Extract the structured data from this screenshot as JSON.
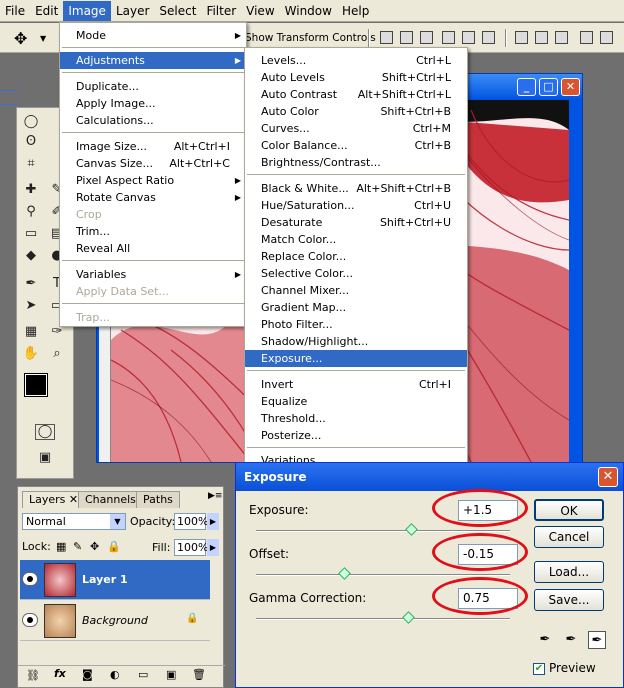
{
  "menubar": {
    "items": [
      "File",
      "Edit",
      "Image",
      "Layer",
      "Select",
      "Filter",
      "View",
      "Window",
      "Help"
    ],
    "active": "Image"
  },
  "optionsbar": {
    "show_transform_controls": "Show Transform Controls"
  },
  "image_menu": {
    "items": [
      {
        "label": "Mode",
        "submenu": true
      },
      {
        "label": "Adjustments",
        "submenu": true,
        "highlighted": true
      },
      {
        "label": "Duplicate..."
      },
      {
        "label": "Apply Image..."
      },
      {
        "label": "Calculations..."
      },
      {
        "label": "Image Size...",
        "shortcut": "Alt+Ctrl+I"
      },
      {
        "label": "Canvas Size...",
        "shortcut": "Alt+Ctrl+C"
      },
      {
        "label": "Pixel Aspect Ratio",
        "submenu": true
      },
      {
        "label": "Rotate Canvas",
        "submenu": true
      },
      {
        "label": "Crop",
        "disabled": true
      },
      {
        "label": "Trim..."
      },
      {
        "label": "Reveal All"
      },
      {
        "label": "Variables",
        "submenu": true
      },
      {
        "label": "Apply Data Set...",
        "disabled": true
      },
      {
        "label": "Trap...",
        "disabled": true
      }
    ]
  },
  "adjustments_menu": {
    "items": [
      {
        "label": "Levels...",
        "shortcut": "Ctrl+L"
      },
      {
        "label": "Auto Levels",
        "shortcut": "Shift+Ctrl+L"
      },
      {
        "label": "Auto Contrast",
        "shortcut": "Alt+Shift+Ctrl+L"
      },
      {
        "label": "Auto Color",
        "shortcut": "Shift+Ctrl+B"
      },
      {
        "label": "Curves...",
        "shortcut": "Ctrl+M"
      },
      {
        "label": "Color Balance...",
        "shortcut": "Ctrl+B"
      },
      {
        "label": "Brightness/Contrast..."
      },
      {
        "label": "Black & White...",
        "shortcut": "Alt+Shift+Ctrl+B"
      },
      {
        "label": "Hue/Saturation...",
        "shortcut": "Ctrl+U"
      },
      {
        "label": "Desaturate",
        "shortcut": "Shift+Ctrl+U"
      },
      {
        "label": "Match Color..."
      },
      {
        "label": "Replace Color..."
      },
      {
        "label": "Selective Color..."
      },
      {
        "label": "Channel Mixer..."
      },
      {
        "label": "Gradient Map..."
      },
      {
        "label": "Photo Filter..."
      },
      {
        "label": "Shadow/Highlight..."
      },
      {
        "label": "Exposure...",
        "highlighted": true
      },
      {
        "label": "Invert",
        "shortcut": "Ctrl+I"
      },
      {
        "label": "Equalize"
      },
      {
        "label": "Threshold..."
      },
      {
        "label": "Posterize..."
      },
      {
        "label": "Variations..."
      }
    ]
  },
  "layers_panel": {
    "tabs": [
      "Layers",
      "Channels",
      "Paths"
    ],
    "blend_mode": "Normal",
    "opacity_label": "Opacity:",
    "opacity": "100%",
    "lock_label": "Lock:",
    "fill_label": "Fill:",
    "fill": "100%",
    "layers": [
      {
        "name": "Layer 1",
        "selected": true
      },
      {
        "name": "Background",
        "locked": true
      }
    ]
  },
  "dialog": {
    "title": "Exposure",
    "exposure_label": "Exposure:",
    "exposure_value": "+1.5",
    "offset_label": "Offset:",
    "offset_value": "-0.15",
    "gamma_label": "Gamma Correction:",
    "gamma_value": "0.75",
    "ok": "OK",
    "cancel": "Cancel",
    "load": "Load...",
    "save": "Save...",
    "preview_label": "Preview",
    "preview_checked": true
  },
  "colors": {
    "highlight": "#316ac5",
    "annotation_red": "#e0101a",
    "hair_red": "#c8303a"
  }
}
